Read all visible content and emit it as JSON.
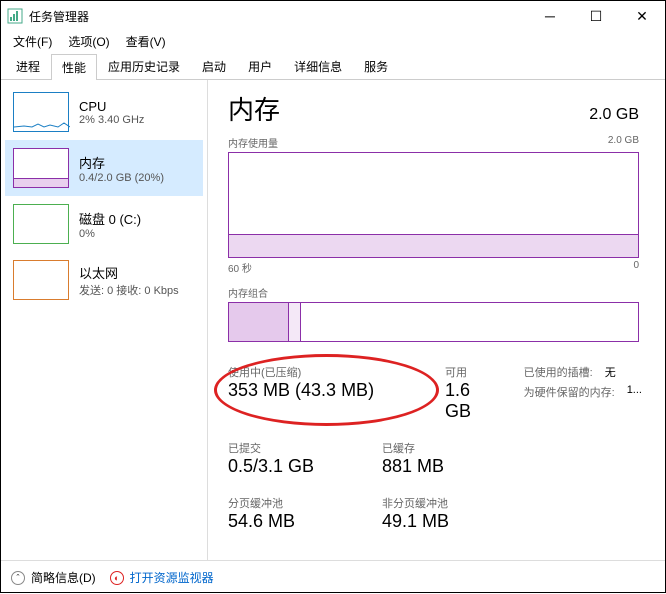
{
  "window": {
    "title": "任务管理器"
  },
  "menu": {
    "file": "文件(F)",
    "options": "选项(O)",
    "view": "查看(V)"
  },
  "tabs": [
    "进程",
    "性能",
    "应用历史记录",
    "启动",
    "用户",
    "详细信息",
    "服务"
  ],
  "active_tab_index": 1,
  "sidebar": {
    "items": [
      {
        "name": "CPU",
        "detail": "2% 3.40 GHz",
        "key": "cpu"
      },
      {
        "name": "内存",
        "detail": "0.4/2.0 GB (20%)",
        "key": "mem"
      },
      {
        "name": "磁盘 0 (C:)",
        "detail": "0%",
        "key": "disk"
      },
      {
        "name": "以太网",
        "detail": "发送: 0 接收: 0 Kbps",
        "key": "eth"
      }
    ],
    "selected_index": 1
  },
  "main": {
    "title": "内存",
    "total": "2.0 GB",
    "usage_label": "内存使用量",
    "usage_max": "2.0 GB",
    "axis_left": "60 秒",
    "axis_right": "0",
    "composition_label": "内存组合",
    "stats": {
      "in_use_label": "使用中(已压缩)",
      "in_use_value": "353 MB (43.3 MB)",
      "available_label": "可用",
      "available_value": "1.6 GB",
      "slots_used_label": "已使用的插槽:",
      "slots_used_value": "无",
      "hw_reserved_label": "为硬件保留的内存:",
      "hw_reserved_value": "1...",
      "committed_label": "已提交",
      "committed_value": "0.5/3.1 GB",
      "cached_label": "已缓存",
      "cached_value": "881 MB",
      "paged_label": "分页缓冲池",
      "paged_value": "54.6 MB",
      "nonpaged_label": "非分页缓冲池",
      "nonpaged_value": "49.1 MB"
    }
  },
  "footer": {
    "fewer_details": "简略信息(D)",
    "resource_monitor": "打开资源监视器"
  },
  "chart_data": {
    "type": "area",
    "title": "内存使用量",
    "xlabel": "60 秒 → 0",
    "ylabel": "GB",
    "ylim": [
      0,
      2.0
    ],
    "series": [
      {
        "name": "内存使用",
        "values_gb": [
          0.44,
          0.44,
          0.44,
          0.43,
          0.43,
          0.43,
          0.42,
          0.42,
          0.42,
          0.42,
          0.42,
          0.42
        ]
      }
    ],
    "approx_percent": 20
  }
}
